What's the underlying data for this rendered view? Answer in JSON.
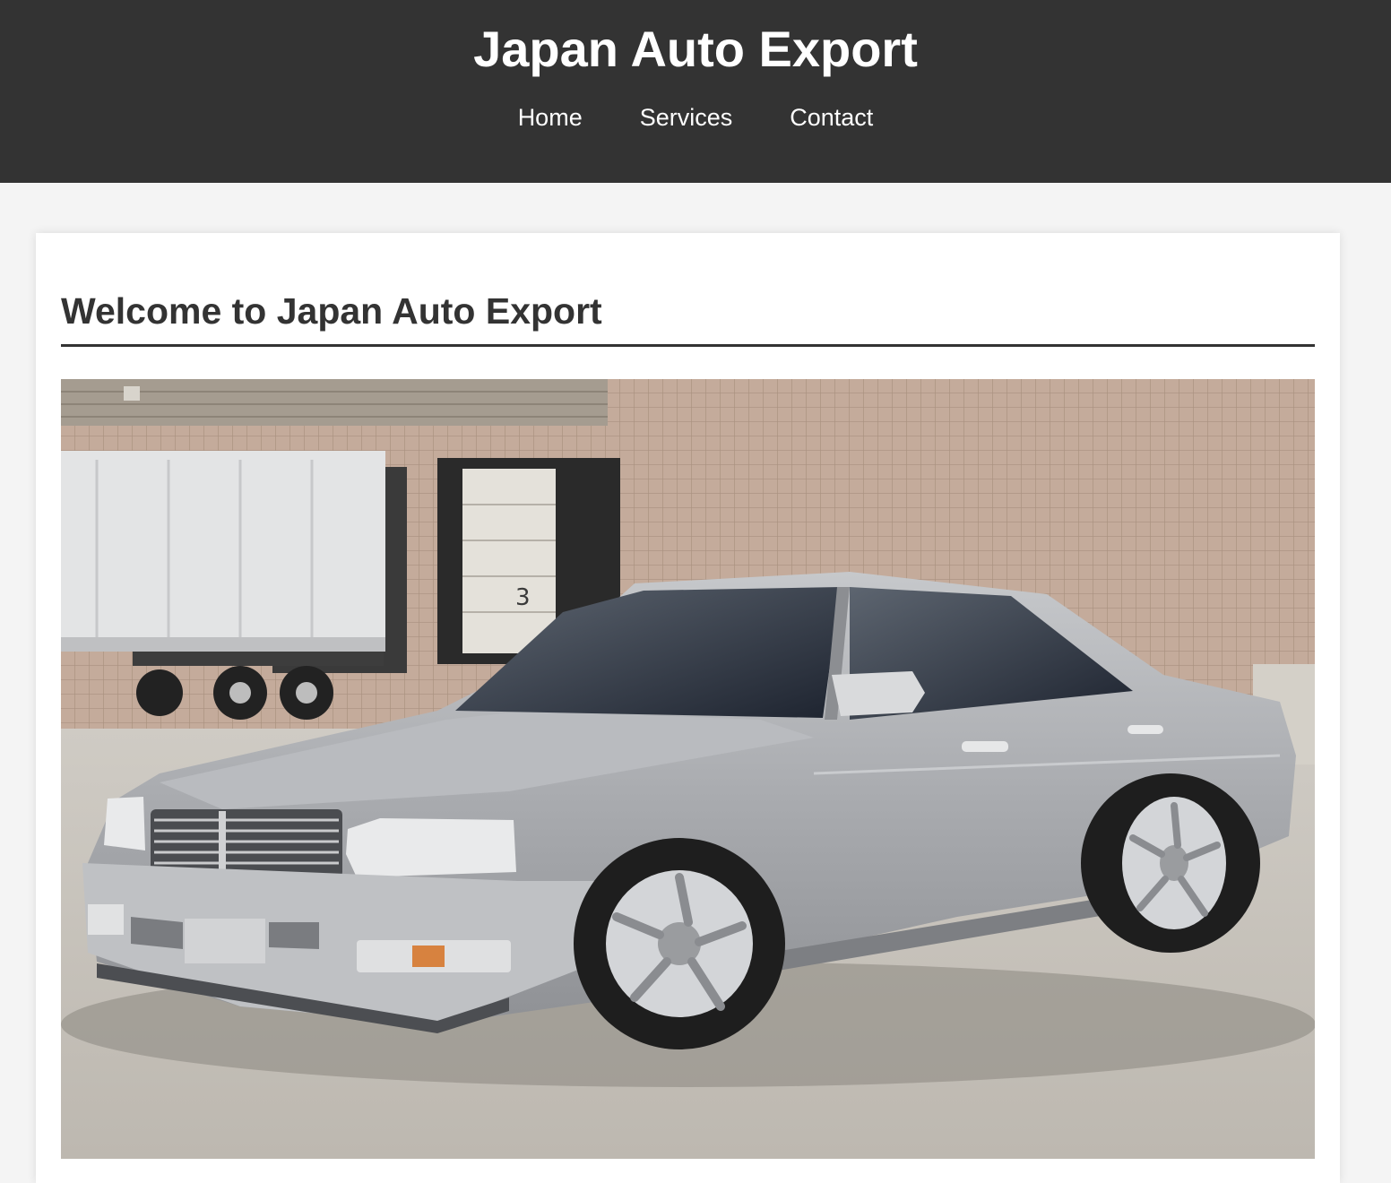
{
  "header": {
    "title": "Japan Auto Export",
    "nav": [
      {
        "label": "Home"
      },
      {
        "label": "Services"
      },
      {
        "label": "Contact"
      }
    ]
  },
  "main": {
    "heading": "Welcome to Japan Auto Export",
    "hero_image": {
      "subject": "silver luxury sedan parked in front of a warehouse loading dock",
      "dock_number": "3"
    }
  },
  "colors": {
    "header_bg": "#333333",
    "page_bg": "#f4f4f4",
    "card_bg": "#ffffff",
    "heading_text": "#333333"
  }
}
